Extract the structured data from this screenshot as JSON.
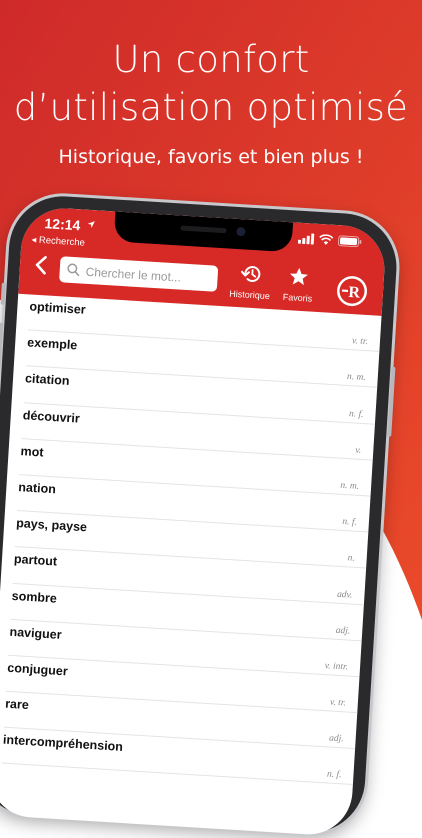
{
  "promo": {
    "headline_line1": "Un confort",
    "headline_line2": "d’utilisation optimisé",
    "subtitle": "Historique, favoris et bien plus !"
  },
  "status_bar": {
    "time": "12:14",
    "back_app": "◂ Recherche"
  },
  "search": {
    "placeholder": "Chercher le mot..."
  },
  "toolbar": {
    "history_label": "Historique",
    "favorites_label": "Favoris",
    "logo_letter": "R"
  },
  "entries": [
    {
      "word": "optimiser",
      "pos": "v. tr."
    },
    {
      "word": "exemple",
      "pos": "n. m."
    },
    {
      "word": "citation",
      "pos": "n. f."
    },
    {
      "word": "découvrir",
      "pos": "v."
    },
    {
      "word": "mot",
      "pos": "n. m."
    },
    {
      "word": "nation",
      "pos": "n. f."
    },
    {
      "word": "pays, payse",
      "pos": "n."
    },
    {
      "word": "partout",
      "pos": "adv."
    },
    {
      "word": "sombre",
      "pos": "adj."
    },
    {
      "word": "naviguer",
      "pos": "v. intr."
    },
    {
      "word": "conjuguer",
      "pos": "v. tr."
    },
    {
      "word": "rare",
      "pos": "adj."
    },
    {
      "word": "intercompréhension",
      "pos": "n. f."
    }
  ],
  "colors": {
    "brand_red": "#d72a27",
    "promo_red": "#e0392b"
  }
}
